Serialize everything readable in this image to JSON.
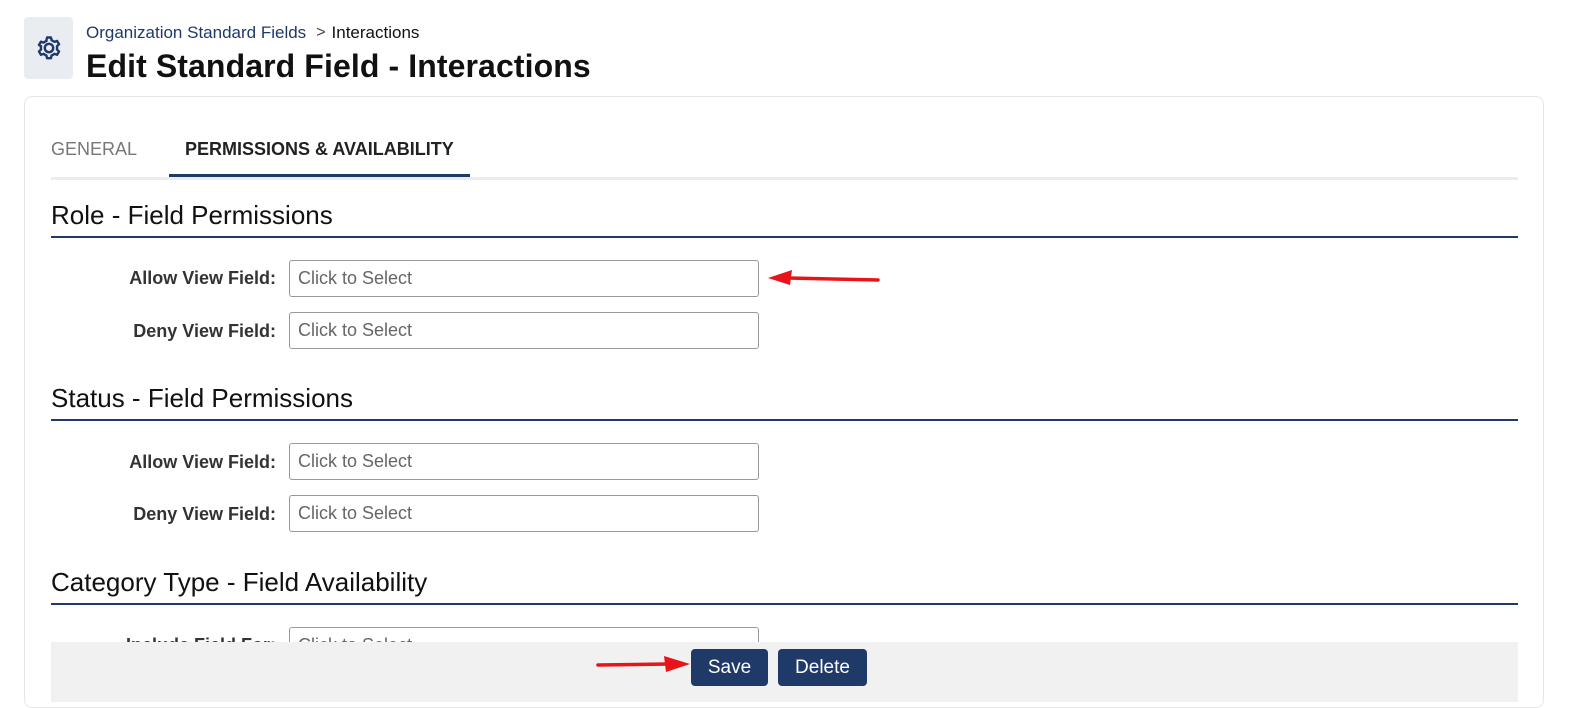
{
  "breadcrumb": {
    "parent": "Organization Standard Fields",
    "separator": ">",
    "current": "Interactions"
  },
  "page_title": "Edit Standard Field - Interactions",
  "page_icon": "gear-icon",
  "tabs": [
    {
      "label": "GENERAL",
      "active": false
    },
    {
      "label": "PERMISSIONS & AVAILABILITY",
      "active": true
    }
  ],
  "sections": [
    {
      "title": "Role - Field Permissions",
      "fields": [
        {
          "label": "Allow View Field:",
          "placeholder": "Click to Select"
        },
        {
          "label": "Deny View Field:",
          "placeholder": "Click to Select"
        }
      ]
    },
    {
      "title": "Status - Field Permissions",
      "fields": [
        {
          "label": "Allow View Field:",
          "placeholder": "Click to Select"
        },
        {
          "label": "Deny View Field:",
          "placeholder": "Click to Select"
        }
      ]
    },
    {
      "title": "Category Type - Field Availability",
      "fields": [
        {
          "label": "Include Field For:",
          "placeholder": "Click to Select"
        }
      ]
    }
  ],
  "actions": {
    "save_label": "Save",
    "delete_label": "Delete"
  },
  "colors": {
    "brand": "#1f3a68",
    "annotation_arrow": "#e8141a"
  }
}
